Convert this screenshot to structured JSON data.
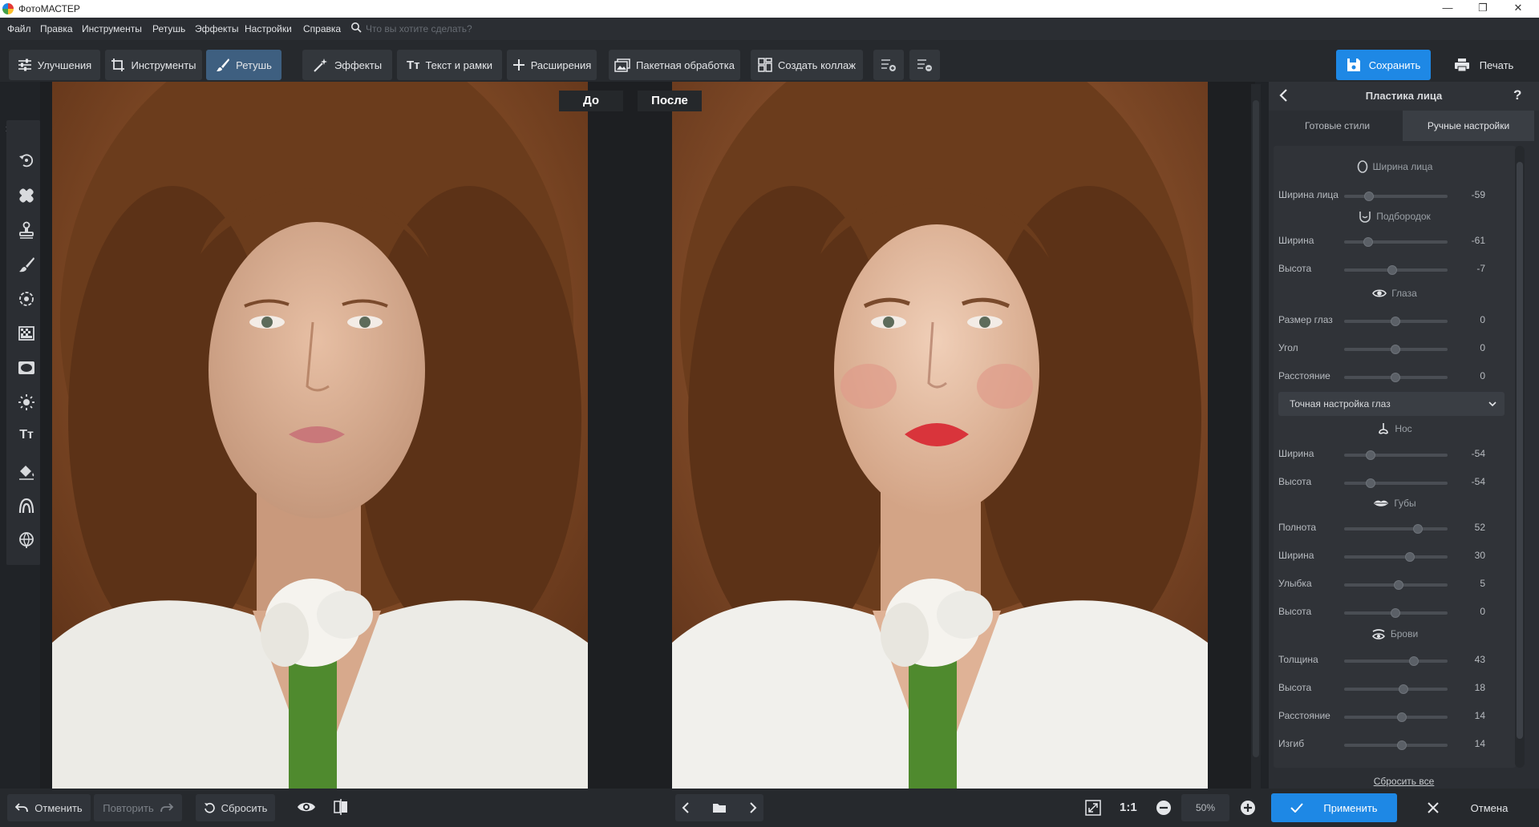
{
  "app": {
    "title": "ФотоМАСТЕР"
  },
  "menu": {
    "items": [
      "Файл",
      "Правка",
      "Инструменты",
      "Ретушь",
      "Эффекты",
      "Настройки",
      "Справка"
    ],
    "search_placeholder": "Что вы хотите сделать?"
  },
  "toolbar": {
    "tabs": [
      {
        "label": "Улучшения",
        "icon": "sliders-icon"
      },
      {
        "label": "Инструменты",
        "icon": "crop-icon"
      },
      {
        "label": "Ретушь",
        "icon": "brush-icon",
        "active": true
      },
      {
        "label": "Эффекты",
        "icon": "magic-wand-icon"
      },
      {
        "label": "Текст и рамки",
        "icon": "text-icon"
      },
      {
        "label": "Расширения",
        "icon": "plus-icon"
      },
      {
        "label": "Пакетная обработка",
        "icon": "images-icon"
      },
      {
        "label": "Создать коллаж",
        "icon": "collage-icon"
      }
    ],
    "save_label": "Сохранить",
    "print_label": "Печать"
  },
  "left_tools": [
    "rotate-tool-icon",
    "healing-patch-icon",
    "stamp-icon",
    "brush-icon",
    "target-icon",
    "gradient-icon",
    "vignette-icon",
    "light-icon",
    "text-icon",
    "fill-bucket-icon",
    "face-icon",
    "globe-icon"
  ],
  "compare": {
    "before_label": "До",
    "after_label": "После"
  },
  "panel": {
    "title": "Пластика лица",
    "help": "?",
    "tabs": [
      {
        "label": "Готовые стили"
      },
      {
        "label": "Ручные настройки",
        "active": true
      }
    ],
    "sections": {
      "face": {
        "title": "Ширина лица",
        "sliders": [
          {
            "label": "Ширина лица",
            "value": -59
          }
        ]
      },
      "chin": {
        "title": "Подбородок",
        "sliders": [
          {
            "label": "Ширина",
            "value": -61
          },
          {
            "label": "Высота",
            "value": -7
          }
        ]
      },
      "eyes": {
        "title": "Глаза",
        "sliders": [
          {
            "label": "Размер глаз",
            "value": 0
          },
          {
            "label": "Угол",
            "value": 0
          },
          {
            "label": "Расстояние",
            "value": 0
          }
        ]
      },
      "eye_fine": "Точная настройка глаз",
      "nose": {
        "title": "Нос",
        "sliders": [
          {
            "label": "Ширина",
            "value": -54
          },
          {
            "label": "Высота",
            "value": -54
          }
        ]
      },
      "lips": {
        "title": "Губы",
        "sliders": [
          {
            "label": "Полнота",
            "value": 52
          },
          {
            "label": "Ширина",
            "value": 30
          },
          {
            "label": "Улыбка",
            "value": 5
          },
          {
            "label": "Высота",
            "value": 0
          }
        ]
      },
      "brows": {
        "title": "Брови",
        "sliders": [
          {
            "label": "Толщина",
            "value": 43
          },
          {
            "label": "Высота",
            "value": 18
          },
          {
            "label": "Расстояние",
            "value": 14
          },
          {
            "label": "Изгиб",
            "value": 14
          }
        ]
      }
    },
    "reset_all": "Сбросить все",
    "apply_label": "Применить",
    "cancel_label": "Отмена"
  },
  "bottom": {
    "undo_label": "Отменить",
    "redo_label": "Повторить",
    "reset_label": "Сбросить",
    "zoom_ratio": "1:1",
    "zoom_level": "50%"
  },
  "colors": {
    "accent": "#1e88e5",
    "active_tab": "#3e5f80",
    "background": "#202327",
    "photo_bg": "#8a4d24"
  }
}
